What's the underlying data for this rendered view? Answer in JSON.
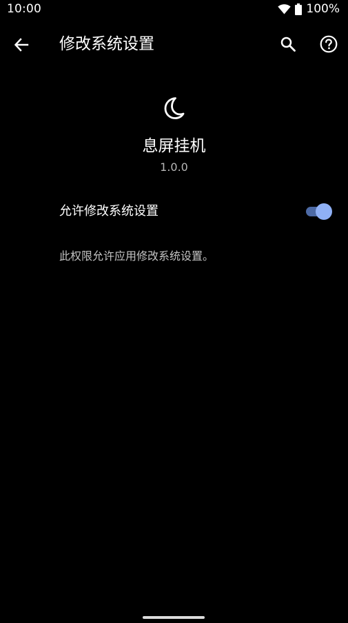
{
  "status_bar": {
    "time": "10:00",
    "battery": "100%",
    "icons": [
      "wifi-icon",
      "battery-icon"
    ]
  },
  "app_bar": {
    "title": "修改系统设置",
    "icons": [
      "back-arrow-icon",
      "search-icon",
      "help-icon"
    ]
  },
  "app": {
    "icon": "crescent-moon-icon",
    "name": "息屏挂机",
    "version": "1.0.0"
  },
  "setting": {
    "label": "允许修改系统设置",
    "enabled": true
  },
  "description": "此权限允许应用修改系统设置。",
  "colors": {
    "background": "#000000",
    "toggle_track": "#4d6aa5",
    "toggle_thumb": "#8fb0f5",
    "secondary_text": "#b8b8b8"
  }
}
